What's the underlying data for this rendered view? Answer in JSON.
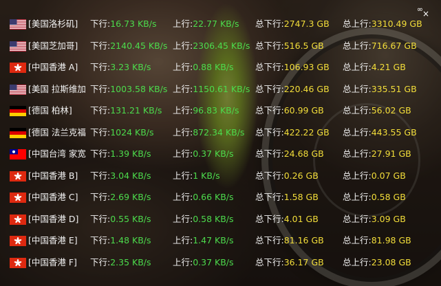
{
  "window": {
    "close_icon": "×",
    "menu_icon": "∞"
  },
  "labels": {
    "download": "下行:",
    "upload": "上行:",
    "total_download": "总下行:",
    "total_upload": "总上行:"
  },
  "colors": {
    "speed_value": "#4cdb4c",
    "total_value": "#f3de3a",
    "label": "#f2f2f2"
  },
  "servers": [
    {
      "flag": "us",
      "name": "[美国洛杉矶]",
      "down": "16.73 KB/s",
      "up": "22.77 KB/s",
      "total_down": "2747.3 GB",
      "total_up": "3310.49 GB"
    },
    {
      "flag": "us",
      "name": "[美国芝加哥]",
      "down": "2140.45 KB/s",
      "up": "2306.45 KB/s",
      "total_down": "516.5 GB",
      "total_up": "716.67 GB"
    },
    {
      "flag": "hk",
      "name": "[中国香港 A]",
      "down": "3.23 KB/s",
      "up": "0.88 KB/s",
      "total_down": "106.93 GB",
      "total_up": "4.21 GB"
    },
    {
      "flag": "us",
      "name": "[美国 拉斯维加",
      "down": "1003.58 KB/s",
      "up": "1150.61 KB/s",
      "total_down": "220.46 GB",
      "total_up": "335.51 GB"
    },
    {
      "flag": "de",
      "name": "[德国 柏林]",
      "down": "131.21 KB/s",
      "up": "96.83 KB/s",
      "total_down": "60.99 GB",
      "total_up": "56.02 GB"
    },
    {
      "flag": "de",
      "name": "[德国 法兰克福",
      "down": "1024 KB/s",
      "up": "872.34 KB/s",
      "total_down": "422.22 GB",
      "total_up": "443.55 GB"
    },
    {
      "flag": "tw",
      "name": "[中国台湾 家宽",
      "down": "1.39 KB/s",
      "up": "0.37 KB/s",
      "total_down": "24.68 GB",
      "total_up": "27.91 GB"
    },
    {
      "flag": "hk",
      "name": "[中国香港 B]",
      "down": "3.04 KB/s",
      "up": "1 KB/s",
      "total_down": "0.26 GB",
      "total_up": "0.07 GB"
    },
    {
      "flag": "hk",
      "name": "[中国香港 C]",
      "down": "2.69 KB/s",
      "up": "0.66 KB/s",
      "total_down": "1.58 GB",
      "total_up": "0.58 GB"
    },
    {
      "flag": "hk",
      "name": "[中国香港 D]",
      "down": "0.55 KB/s",
      "up": "0.58 KB/s",
      "total_down": "4.01 GB",
      "total_up": "3.09 GB"
    },
    {
      "flag": "hk",
      "name": "[中国香港 E]",
      "down": "1.48 KB/s",
      "up": "1.47 KB/s",
      "total_down": "81.16 GB",
      "total_up": "81.98 GB"
    },
    {
      "flag": "hk",
      "name": "[中国香港 F]",
      "down": "2.35 KB/s",
      "up": "0.37 KB/s",
      "total_down": "36.17 GB",
      "total_up": "23.08 GB"
    }
  ]
}
